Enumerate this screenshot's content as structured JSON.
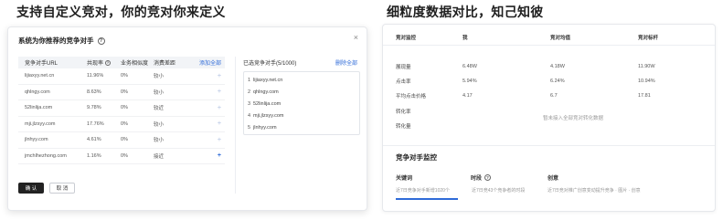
{
  "left_heading": "支持自定义竞对，你的竞对你来定义",
  "right_heading": "细粒度数据对比，知己知彼",
  "modal": {
    "title": "系统为你推荐的竞争对手",
    "table_headers": {
      "url": "竞争对手URL",
      "share": "共现率",
      "similarity": "业务相似度",
      "preference": "消费差距",
      "add_all": "添加全部"
    },
    "rows": [
      {
        "url": "lijiaxyy.net.cn",
        "share": "11.96%",
        "similarity": "0%",
        "preference": "较小",
        "added": false
      },
      {
        "url": "qhlngy.com",
        "share": "8.63%",
        "similarity": "0%",
        "preference": "较小",
        "added": false
      },
      {
        "url": "52linlija.com",
        "share": "9.78%",
        "similarity": "0%",
        "preference": "较近",
        "added": false
      },
      {
        "url": "mji.jlzsyy.com",
        "share": "17.76%",
        "similarity": "0%",
        "preference": "较小",
        "added": false
      },
      {
        "url": "jlnhyy.com",
        "share": "4.61%",
        "similarity": "0%",
        "preference": "较小",
        "added": false
      },
      {
        "url": "jmchlhezhong.com",
        "share": "1.16%",
        "similarity": "0%",
        "preference": "接近",
        "added": true
      }
    ],
    "add_icon": "+",
    "selected_header": "已选竞争对手(5/1000)",
    "clear_all": "删除全部",
    "selected": [
      {
        "num": "1",
        "url": "lijiaxyy.net.cn"
      },
      {
        "num": "2",
        "url": "qhlngy.com"
      },
      {
        "num": "3",
        "url": "52linlija.com"
      },
      {
        "num": "4",
        "url": "mji.jlzsyy.com"
      },
      {
        "num": "5",
        "url": "jlnhyy.com"
      }
    ],
    "ok_label": "确 认",
    "cancel_label": "取 消",
    "close_icon": "×"
  },
  "compare": {
    "headers": {
      "metric": "竞对监控",
      "self": "我",
      "avg": "竞对均值",
      "best": "竞对标杆"
    },
    "rows": [
      {
        "metric": "展现量",
        "self": "6.48W",
        "avg": "4.18W",
        "best": "11.90W"
      },
      {
        "metric": "点击率",
        "self": "5.94%",
        "avg": "6.24%",
        "best": "10.94%"
      },
      {
        "metric": "平均点击价格",
        "self": "4.17",
        "avg": "6.7",
        "best": "17.81"
      },
      {
        "metric": "转化率",
        "self": "",
        "avg": "",
        "best": ""
      },
      {
        "metric": "转化量",
        "self": "",
        "avg": "",
        "best": ""
      }
    ],
    "empty_text": "暂未接入全部竞对转化数据"
  },
  "monitor": {
    "title": "竞争对手监控",
    "tabs": [
      {
        "label": "关键词",
        "desc": "近7日竞争对手新增1020个"
      },
      {
        "label": "时段",
        "desc": "近7日竞43个竞争者的时段"
      },
      {
        "label": "创意",
        "desc": "近7日竞对推广创意变动提升竞争 · 图片 · 创意"
      }
    ]
  },
  "colors": {
    "accent": "#2f6bd8",
    "primary_button": "#222222"
  }
}
